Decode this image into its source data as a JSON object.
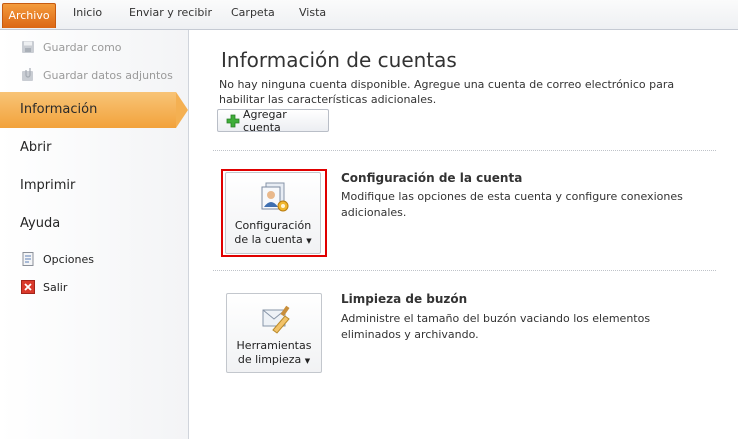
{
  "ribbon": {
    "tabs": [
      {
        "label": "Archivo",
        "active": true
      },
      {
        "label": "Inicio"
      },
      {
        "label": "Enviar y recibir"
      },
      {
        "label": "Carpeta"
      },
      {
        "label": "Vista"
      }
    ],
    "accent_color": "#e07020"
  },
  "sidebar": {
    "commands_top": [
      {
        "label": "Guardar como",
        "icon": "save-as-icon",
        "enabled": false
      },
      {
        "label": "Guardar datos adjuntos",
        "icon": "save-attachments-icon",
        "enabled": false
      }
    ],
    "nav": [
      {
        "label": "Información",
        "selected": true
      },
      {
        "label": "Abrir"
      },
      {
        "label": "Imprimir"
      },
      {
        "label": "Ayuda"
      }
    ],
    "commands_bottom": [
      {
        "label": "Opciones",
        "icon": "options-icon"
      },
      {
        "label": "Salir",
        "icon": "exit-icon"
      }
    ]
  },
  "main": {
    "title": "Información de cuentas",
    "description": "No hay ninguna cuenta disponible. Agregue una cuenta de correo electrónico para habilitar las características adicionales.",
    "add_account_label": "Agregar cuenta",
    "sections": [
      {
        "button_line1": "Configuración",
        "button_line2": "de la cuenta",
        "title": "Configuración de la cuenta",
        "description": "Modifique las opciones de esta cuenta y configure conexiones adicionales.",
        "icon": "account-settings-icon",
        "highlighted": true
      },
      {
        "button_line1": "Herramientas",
        "button_line2": "de limpieza",
        "title": "Limpieza de buzón",
        "description": "Administre el tamaño del buzón vaciando los elementos eliminados y archivando.",
        "icon": "cleanup-tools-icon",
        "highlighted": false
      }
    ],
    "highlight_color": "#e00000"
  }
}
